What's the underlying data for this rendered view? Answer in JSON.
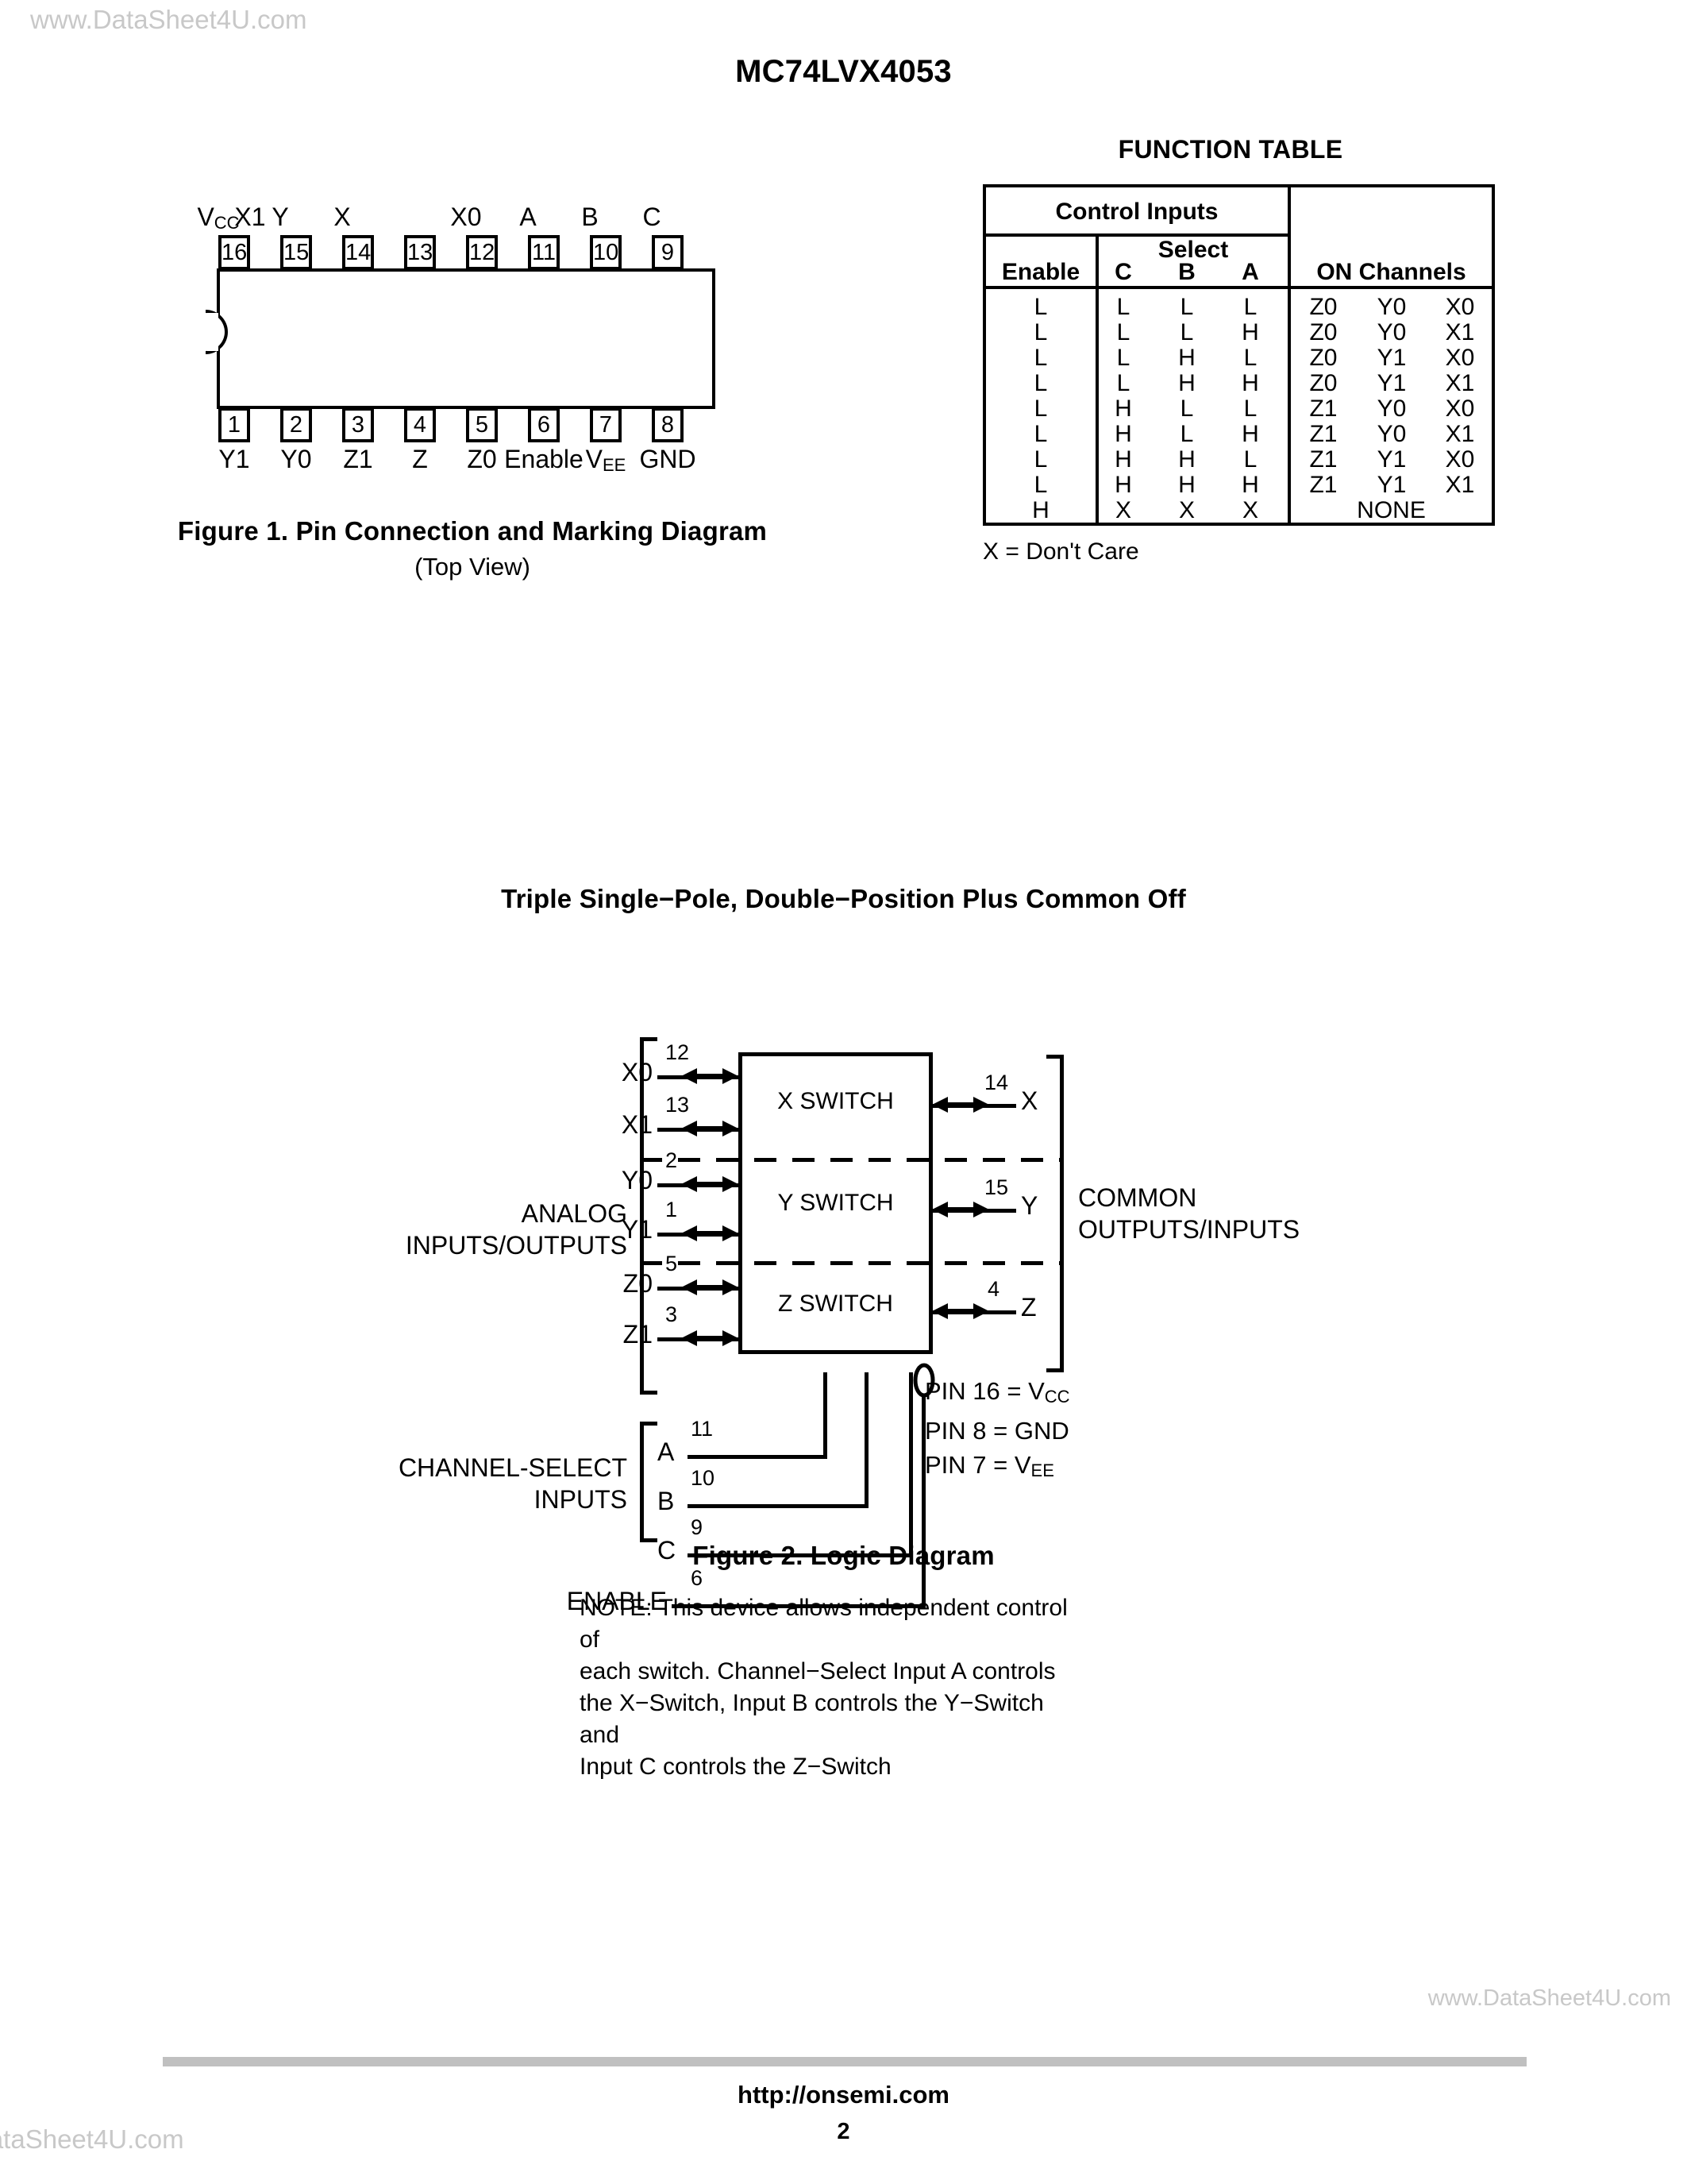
{
  "watermarks": {
    "top_left": "www.DataSheet4U.com",
    "bottom_right": "www.DataSheet4U.com",
    "bottom_left": "DataSheet4U.com"
  },
  "page_title": "MC74LVX4053",
  "figure1": {
    "caption_line1": "Figure 1. Pin Connection and Marking Diagram",
    "caption_line2": "(Top View)",
    "top_pins": [
      {
        "number": "16",
        "label": "V",
        "sub": "CC"
      },
      {
        "number": "15",
        "label": "Y",
        "sub": ""
      },
      {
        "number": "14",
        "label": "X",
        "sub": ""
      },
      {
        "number": "13",
        "label": "X1",
        "sub": ""
      },
      {
        "number": "12",
        "label": "X0",
        "sub": ""
      },
      {
        "number": "11",
        "label": "A",
        "sub": ""
      },
      {
        "number": "10",
        "label": "B",
        "sub": ""
      },
      {
        "number": "9",
        "label": "C",
        "sub": ""
      }
    ],
    "bottom_pins": [
      {
        "number": "1",
        "label": "Y1",
        "sub": ""
      },
      {
        "number": "2",
        "label": "Y0",
        "sub": ""
      },
      {
        "number": "3",
        "label": "Z1",
        "sub": ""
      },
      {
        "number": "4",
        "label": "Z",
        "sub": ""
      },
      {
        "number": "5",
        "label": "Z0",
        "sub": ""
      },
      {
        "number": "6",
        "label": "Enable",
        "sub": ""
      },
      {
        "number": "7",
        "label": "V",
        "sub": "EE"
      },
      {
        "number": "8",
        "label": "GND",
        "sub": ""
      }
    ]
  },
  "function_table": {
    "title": "FUNCTION TABLE",
    "group_header": "Control Inputs",
    "select_header": "Select",
    "col_enable": "Enable",
    "col_c": "C",
    "col_b": "B",
    "col_a": "A",
    "col_on_channels": "ON Channels",
    "note": "X = Don't Care",
    "rows": [
      {
        "enable": "L",
        "c": "L",
        "b": "L",
        "a": "L",
        "ch1": "Z0",
        "ch2": "Y0",
        "ch3": "X0",
        "none": ""
      },
      {
        "enable": "L",
        "c": "L",
        "b": "L",
        "a": "H",
        "ch1": "Z0",
        "ch2": "Y0",
        "ch3": "X1",
        "none": ""
      },
      {
        "enable": "L",
        "c": "L",
        "b": "H",
        "a": "L",
        "ch1": "Z0",
        "ch2": "Y1",
        "ch3": "X0",
        "none": ""
      },
      {
        "enable": "L",
        "c": "L",
        "b": "H",
        "a": "H",
        "ch1": "Z0",
        "ch2": "Y1",
        "ch3": "X1",
        "none": ""
      },
      {
        "enable": "L",
        "c": "H",
        "b": "L",
        "a": "L",
        "ch1": "Z1",
        "ch2": "Y0",
        "ch3": "X0",
        "none": ""
      },
      {
        "enable": "L",
        "c": "H",
        "b": "L",
        "a": "H",
        "ch1": "Z1",
        "ch2": "Y0",
        "ch3": "X1",
        "none": ""
      },
      {
        "enable": "L",
        "c": "H",
        "b": "H",
        "a": "L",
        "ch1": "Z1",
        "ch2": "Y1",
        "ch3": "X0",
        "none": ""
      },
      {
        "enable": "L",
        "c": "H",
        "b": "H",
        "a": "H",
        "ch1": "Z1",
        "ch2": "Y1",
        "ch3": "X1",
        "none": ""
      },
      {
        "enable": "H",
        "c": "X",
        "b": "X",
        "a": "X",
        "ch1": "",
        "ch2": "",
        "ch3": "",
        "none": "NONE"
      }
    ]
  },
  "figure2": {
    "title": "Triple Single−Pole, Double−Position Plus Common Off",
    "caption": "Figure 2. Logic Diagram",
    "switches": [
      {
        "name": "X SWITCH"
      },
      {
        "name": "Y SWITCH"
      },
      {
        "name": "Z SWITCH"
      }
    ],
    "analog_label_line1": "ANALOG",
    "analog_label_line2": "INPUTS/OUTPUTS",
    "common_label_line1": "COMMON",
    "common_label_line2": "OUTPUTS/INPUTS",
    "select_label_line1": "CHANNEL-SELECT",
    "select_label_line2": "INPUTS",
    "enable_label": "ENABLE",
    "analog_inputs": [
      {
        "name": "X0",
        "pin": "12"
      },
      {
        "name": "X1",
        "pin": "13"
      },
      {
        "name": "Y0",
        "pin": "2"
      },
      {
        "name": "Y1",
        "pin": "1"
      },
      {
        "name": "Z0",
        "pin": "5"
      },
      {
        "name": "Z1",
        "pin": "3"
      }
    ],
    "common_outputs": [
      {
        "name": "X",
        "pin": "14"
      },
      {
        "name": "Y",
        "pin": "15"
      },
      {
        "name": "Z",
        "pin": "4"
      }
    ],
    "select_inputs": [
      {
        "name": "A",
        "pin": "11"
      },
      {
        "name": "B",
        "pin": "10"
      },
      {
        "name": "C",
        "pin": "9"
      }
    ],
    "enable_pin": "6",
    "pin_legend": [
      {
        "text": "PIN 16 = V",
        "sub": "CC"
      },
      {
        "text": "PIN 8 = GND",
        "sub": ""
      },
      {
        "text": "PIN 7 = V",
        "sub": "EE"
      }
    ],
    "note_lines": [
      "NOTE: This device allows independent control of",
      "each switch. Channel−Select Input A controls",
      "the X−Switch, Input B controls the Y−Switch and",
      "Input C controls the Z−Switch"
    ]
  },
  "footer": {
    "url": "http://onsemi.com",
    "page_number": "2"
  }
}
